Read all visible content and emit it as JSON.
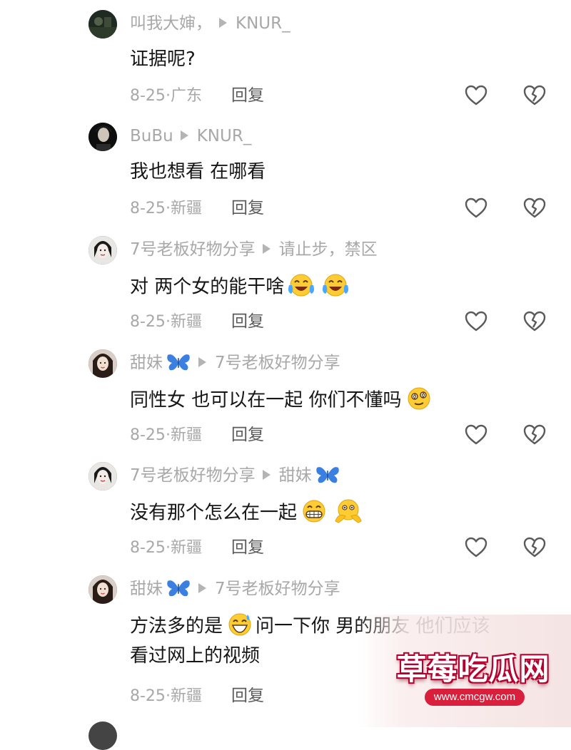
{
  "comments": [
    {
      "user": "叫我大婶，",
      "reply_to": "KNUR_",
      "badge": "",
      "lines": [
        "证据呢?"
      ],
      "emojis": [],
      "date": "8-25",
      "location": "广东",
      "reply_label": "回复",
      "avatar": "dark-scene"
    },
    {
      "user": "BuBu",
      "reply_to": "KNUR_",
      "badge": "",
      "lines": [
        "我也想看 在哪看"
      ],
      "emojis": [],
      "date": "8-25",
      "location": "新疆",
      "reply_label": "回复",
      "avatar": "dark-portrait"
    },
    {
      "user": "7号老板好物分享",
      "reply_to": "请止步，禁区",
      "badge": "",
      "lines": [
        "对  两个女的能干啥"
      ],
      "emojis": [
        "tears-of-joy",
        "tears-of-joy"
      ],
      "date": "8-25",
      "location": "新疆",
      "reply_label": "回复",
      "avatar": "light-portrait"
    },
    {
      "user": "甜妹",
      "reply_to": "7号老板好物分享",
      "badge": "butterfly",
      "lines": [
        "同性女 也可以在一起 你们不懂吗"
      ],
      "emojis": [
        "dizzy-face"
      ],
      "date": "8-25",
      "location": "新疆",
      "reply_label": "回复",
      "avatar": "woman-portrait"
    },
    {
      "user": "7号老板好物分享",
      "reply_to": "甜妹",
      "badge_on_reply": "butterfly",
      "lines": [
        "没有那个怎么在一起"
      ],
      "emojis": [
        "grimacing",
        "peeking"
      ],
      "date": "8-25",
      "location": "新疆",
      "reply_label": "回复",
      "avatar": "light-portrait"
    },
    {
      "user": "甜妹",
      "reply_to": "7号老板好物分享",
      "badge": "butterfly",
      "lines": [
        "方法多的是",
        "问一下你  男的朋友 他们应该",
        "看过网上的视频"
      ],
      "emojis": [
        "sweat-smile"
      ],
      "date": "8-25",
      "location": "新疆",
      "reply_label": "回复",
      "avatar": "woman-portrait"
    }
  ],
  "watermark": {
    "title": "草莓吃瓜网",
    "url": "www.cmcgw.com"
  },
  "colors": {
    "username": "#a8a8a8",
    "text": "#161616",
    "meta": "#a8a8a8",
    "reply": "#5b5b5b",
    "badge": "#3b7fe0",
    "icon_stroke": "#5a5a5a"
  }
}
